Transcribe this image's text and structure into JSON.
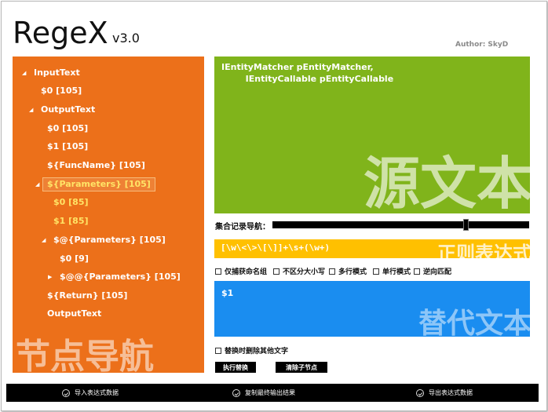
{
  "app": {
    "title": "RegeX",
    "version": "v3.0",
    "author": "Author: SkyD"
  },
  "tree": {
    "watermark": "节点导航",
    "nodes": [
      {
        "label": "InputText"
      },
      {
        "label": "$0 [105]"
      },
      {
        "label": "OutputText"
      },
      {
        "label": "$0 [105]"
      },
      {
        "label": "$1 [105]"
      },
      {
        "label": "${FuncName} [105]"
      },
      {
        "label": "${Parameters} [105]"
      },
      {
        "label": "$0 [85]"
      },
      {
        "label": "$1 [85]"
      },
      {
        "label": "$@{Parameters} [105]"
      },
      {
        "label": "$0 [9]"
      },
      {
        "label": "$@@{Parameters} [105]"
      },
      {
        "label": "${Return} [105]"
      },
      {
        "label": "OutputText"
      }
    ]
  },
  "source": {
    "text": "IEntityMatcher pEntityMatcher,\n        IEntityCallable pEntityCallable",
    "watermark": "源文本"
  },
  "navigation": {
    "label": "集合记录导航：",
    "position": 0.75
  },
  "regex": {
    "value": "[\\w\\<\\>\\[\\]]+\\s+(\\w+)",
    "watermark": "正则表达式"
  },
  "options": [
    {
      "label": "仅捕获命名组",
      "checked": false
    },
    {
      "label": "不区分大小写",
      "checked": false
    },
    {
      "label": "多行模式",
      "checked": false
    },
    {
      "label": "单行模式",
      "checked": false
    },
    {
      "label": "逆向匹配",
      "checked": false
    }
  ],
  "replace": {
    "text": "$1",
    "watermark": "替代文本",
    "delete_other_label": "替换时删除其他文字"
  },
  "buttons": {
    "execute": "执行替换",
    "clear": "清除子节点"
  },
  "bottom_bar": {
    "import": "导入表达式数据",
    "copy": "复制最终输出结果",
    "export": "导出表达式数据"
  },
  "colors": {
    "tree_panel": "#ec701a",
    "source_panel": "#80b41b",
    "regex_panel": "#ffc000",
    "replace_panel": "#1a8df0"
  }
}
